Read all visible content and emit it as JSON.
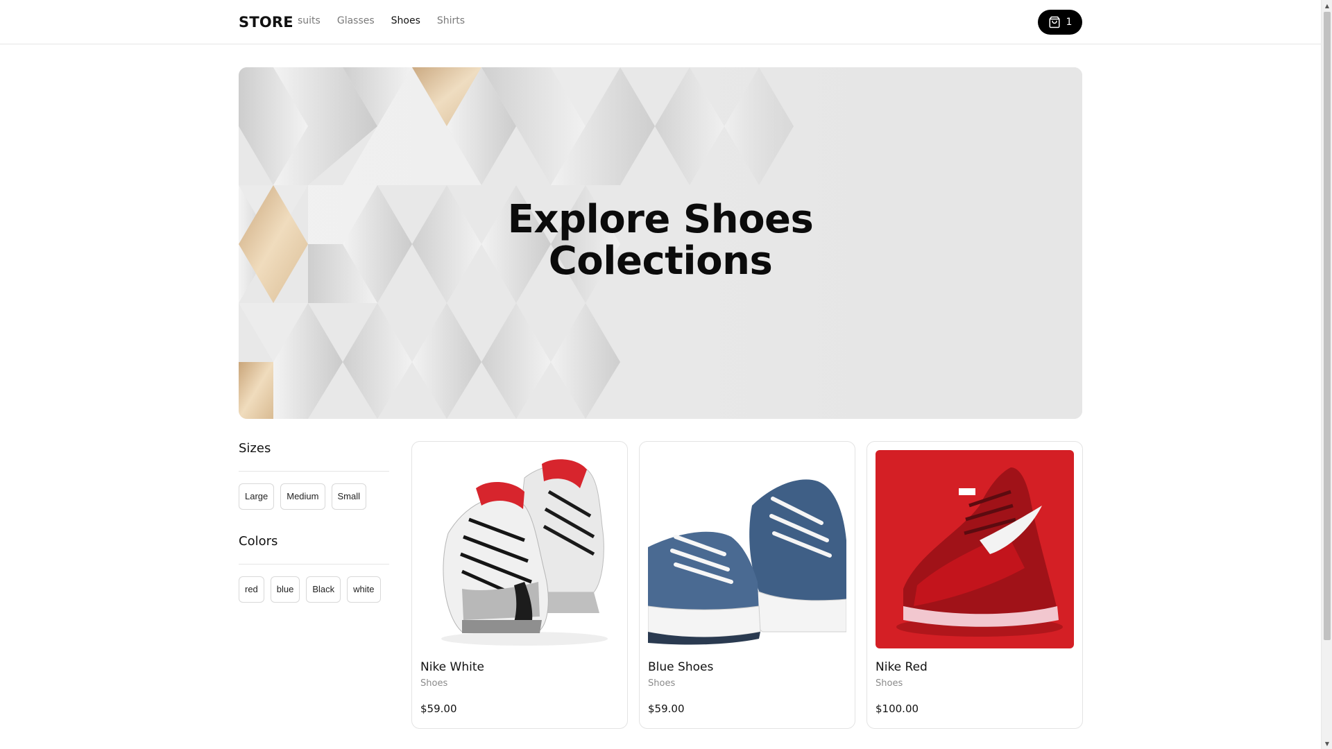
{
  "header": {
    "logo": "STORE",
    "nav": [
      {
        "label": "suits",
        "active": false
      },
      {
        "label": "Glasses",
        "active": false
      },
      {
        "label": "Shoes",
        "active": true
      },
      {
        "label": "Shirts",
        "active": false
      }
    ],
    "cart_count": "1",
    "cart_icon": "shopping-bag-icon"
  },
  "hero": {
    "title_line1": "Explore Shoes",
    "title_line2": "Colections"
  },
  "filters": {
    "sizes_heading": "Sizes",
    "sizes": [
      "Large",
      "Medium",
      "Small"
    ],
    "colors_heading": "Colors",
    "colors": [
      "red",
      "blue",
      "Black",
      "white"
    ]
  },
  "products": [
    {
      "name": "Nike White",
      "category": "Shoes",
      "price": "$59.00"
    },
    {
      "name": "Blue Shoes",
      "category": "Shoes",
      "price": "$59.00"
    },
    {
      "name": "Nike Red",
      "category": "Shoes",
      "price": "$100.00"
    }
  ],
  "colors": {
    "accent": "#000000",
    "hero_bg": "#e6e6e6",
    "gold": "#d8b98a",
    "red_product_bg": "#d41f25"
  }
}
